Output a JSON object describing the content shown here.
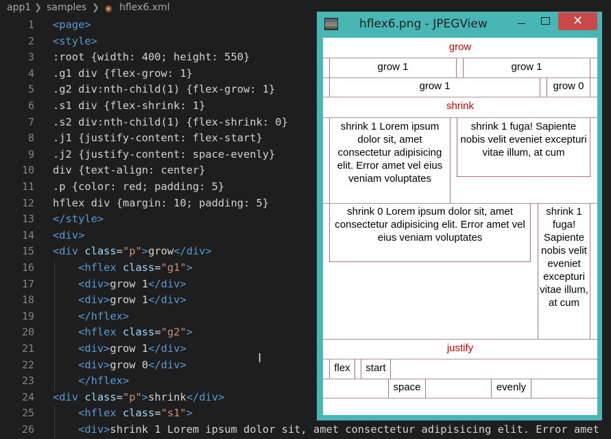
{
  "breadcrumb": {
    "root": "app1",
    "folder": "samples",
    "file": "hflex6.xml"
  },
  "editor": {
    "lines": [
      {
        "n": "1",
        "html": "<span class='tag'>&lt;page&gt;</span>"
      },
      {
        "n": "2",
        "html": "<span class='tag'>&lt;style&gt;</span>"
      },
      {
        "n": "3",
        "html": ":root {width: 400; height: 550}"
      },
      {
        "n": "4",
        "html": ".g1 div {flex-grow: 1}"
      },
      {
        "n": "5",
        "html": ".g2 div:nth-child(1) {flex-grow: 1}"
      },
      {
        "n": "6",
        "html": ".s1 div {flex-shrink: 1}"
      },
      {
        "n": "7",
        "html": ".s2 div:nth-child(1) {flex-shrink: 0}"
      },
      {
        "n": "8",
        "html": ".j1 {justify-content: flex-start}"
      },
      {
        "n": "9",
        "html": ".j2 {justify-content: space-evenly}"
      },
      {
        "n": "10",
        "html": "div {text-align: center}"
      },
      {
        "n": "11",
        "html": ".p {color: red; padding: 5}"
      },
      {
        "n": "12",
        "html": "hflex div {margin: 10; padding: 5}"
      },
      {
        "n": "13",
        "html": "<span class='tag'>&lt;/style&gt;</span>"
      },
      {
        "n": "14",
        "html": "<span class='tag'>&lt;div&gt;</span>"
      },
      {
        "n": "15",
        "html": "<span class='tag'>&lt;div</span> <span class='at'>class</span>=<span class='str'>\"p\"</span><span class='tag'>&gt;</span>grow<span class='tag'>&lt;/div&gt;</span>"
      },
      {
        "n": "16",
        "html": "    <span class='tag'>&lt;hflex</span> <span class='at'>class</span>=<span class='str'>\"g1\"</span><span class='tag'>&gt;</span>"
      },
      {
        "n": "17",
        "html": "    <span class='tag'>&lt;div&gt;</span>grow 1<span class='tag'>&lt;/div&gt;</span>"
      },
      {
        "n": "18",
        "html": "    <span class='tag'>&lt;div&gt;</span>grow 1<span class='tag'>&lt;/div&gt;</span>"
      },
      {
        "n": "19",
        "html": "    <span class='tag'>&lt;/hflex&gt;</span>"
      },
      {
        "n": "20",
        "html": "    <span class='tag'>&lt;hflex</span> <span class='at'>class</span>=<span class='str'>\"g2\"</span><span class='tag'>&gt;</span>"
      },
      {
        "n": "21",
        "html": "    <span class='tag'>&lt;div&gt;</span>grow 1<span class='tag'>&lt;/div&gt;</span>"
      },
      {
        "n": "22",
        "html": "    <span class='tag'>&lt;div&gt;</span>grow 0<span class='tag'>&lt;/div&gt;</span>"
      },
      {
        "n": "23",
        "html": "    <span class='tag'>&lt;/hflex&gt;</span>"
      },
      {
        "n": "24",
        "html": "<span class='tag'>&lt;div</span> <span class='at'>class</span>=<span class='str'>\"p\"</span><span class='tag'>&gt;</span>shrink<span class='tag'>&lt;/div&gt;</span>"
      },
      {
        "n": "25",
        "html": "    <span class='tag'>&lt;hflex</span> <span class='at'>class</span>=<span class='str'>\"s1\"</span><span class='tag'>&gt;</span>"
      },
      {
        "n": "26",
        "html": "    <span class='tag'>&lt;div&gt;</span>shrink 1 Lorem ipsum dolor sit, amet consectetur adipisicing elit. Error amet"
      }
    ]
  },
  "viewer": {
    "title": "hflex6.png - JPEGView",
    "close_glyph": "✕",
    "grow_label": "grow",
    "g1": [
      "grow 1",
      "grow 1"
    ],
    "g2": [
      "grow 1",
      "grow 0"
    ],
    "shrink_label": "shrink",
    "s1": [
      "shrink 1 Lorem ipsum dolor sit, amet consectetur adipisicing elit. Error amet vel eius veniam voluptates",
      "shrink 1 fuga! Sapiente nobis velit eveniet excepturi vitae illum, at cum"
    ],
    "s2": [
      "shrink 0 Lorem ipsum dolor sit, amet consectetur adipisicing elit. Error amet vel eius veniam voluptates",
      "shrink 1 fuga! Sapiente nobis velit eveniet excepturi vitae illum, at cum"
    ],
    "justify_label": "justify",
    "j1": [
      "flex",
      "start"
    ],
    "j2": [
      "space",
      "evenly"
    ]
  },
  "colors": {
    "editor_bg": "#1e1e1e",
    "tag": "#569cd6",
    "attr": "#9cdcfe",
    "string": "#ce9178",
    "window_frame": "#48b6b4",
    "close": "#c94848",
    "label_red": "#d00000"
  }
}
